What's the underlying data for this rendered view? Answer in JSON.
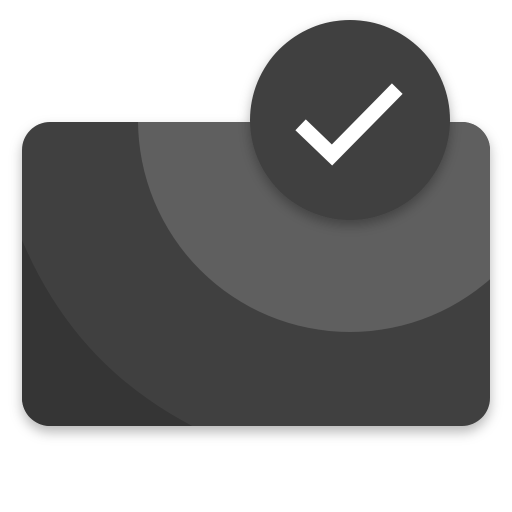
{
  "icon": {
    "name": "card-verified-icon",
    "card_icon": "card-icon",
    "badge_icon": "checkmark-icon"
  },
  "colors": {
    "background": "#ffffff",
    "card_base": "#414141",
    "card_shadow_region": "#353535",
    "card_highlight_arc": "#5e5e5e",
    "badge_fill": "#3f3f3f",
    "checkmark": "#ffffff"
  }
}
